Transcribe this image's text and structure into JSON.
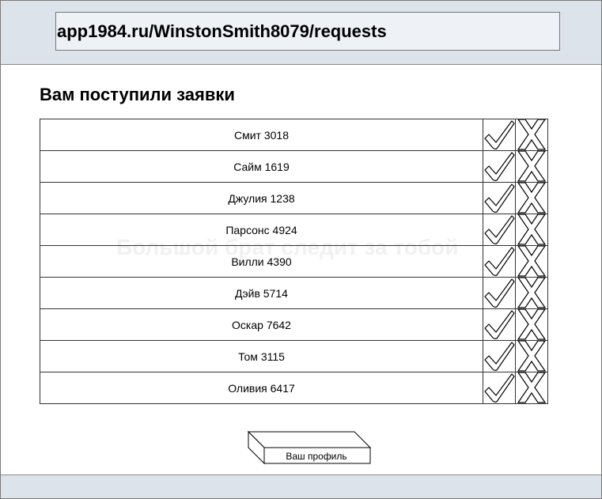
{
  "address_bar": {
    "url": "app1984.ru/WinstonSmith8079/requests"
  },
  "page": {
    "title": "Вам поступили заявки",
    "watermark": "Большой брат следит за тобой"
  },
  "requests": [
    {
      "name": "Смит 3018"
    },
    {
      "name": "Сайм 1619"
    },
    {
      "name": "Джулия 1238"
    },
    {
      "name": "Парсонс 4924"
    },
    {
      "name": "Вилли 4390"
    },
    {
      "name": "Дэйв 5714"
    },
    {
      "name": "Оскар 7642"
    },
    {
      "name": "Том 3115"
    },
    {
      "name": "Оливия 6417"
    }
  ],
  "icons": {
    "accept": "check-icon",
    "reject": "cross-icon"
  },
  "footer": {
    "profile_button": "Ваш профиль"
  },
  "colors": {
    "bars": "#dde3ea",
    "address_field": "#eef1f5",
    "lines": "#333333"
  }
}
